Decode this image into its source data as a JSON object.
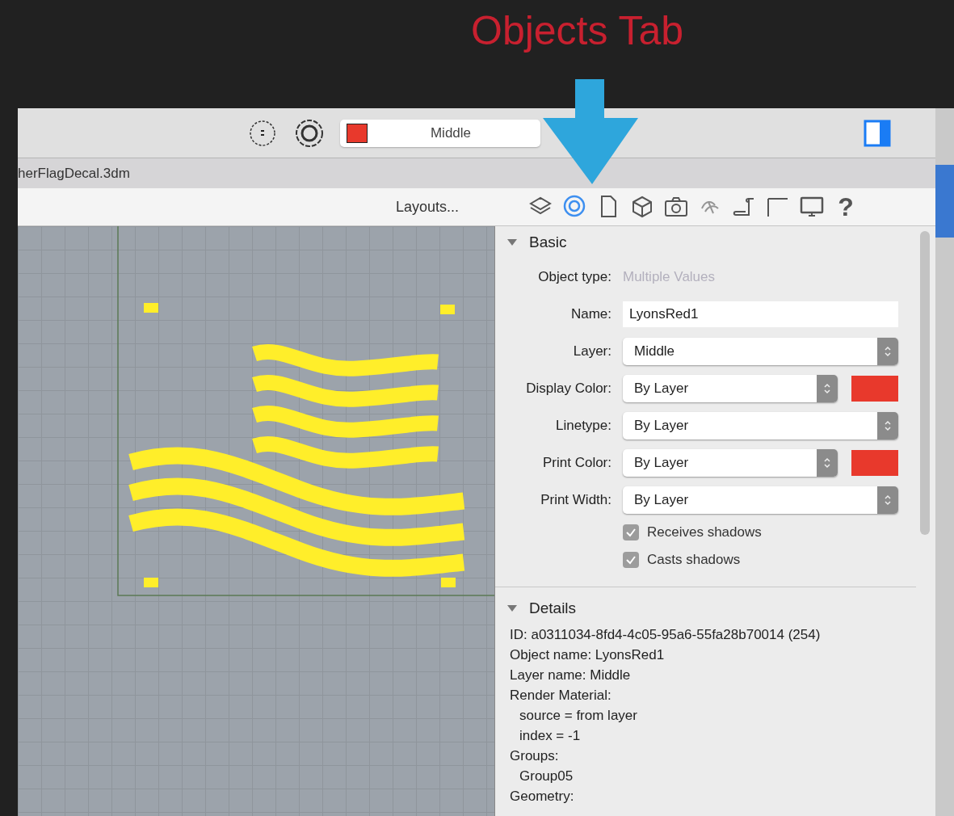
{
  "annotation": {
    "title": "Objects Tab"
  },
  "toolbar": {
    "layer": {
      "name": "Middle",
      "color": "#e8392c"
    }
  },
  "document_tab": {
    "title": "herFlagDecal.3dm"
  },
  "layouts_button": {
    "label": "Layouts..."
  },
  "panel_tabs": [
    {
      "kind": "layers",
      "selected": false
    },
    {
      "kind": "objects",
      "selected": true
    },
    {
      "kind": "document",
      "selected": false
    },
    {
      "kind": "box",
      "selected": false
    },
    {
      "kind": "camera",
      "selected": false
    },
    {
      "kind": "lights",
      "selected": false
    },
    {
      "kind": "scroll",
      "selected": false
    },
    {
      "kind": "line",
      "selected": false
    },
    {
      "kind": "display",
      "selected": false
    },
    {
      "kind": "help",
      "selected": false,
      "label": "?"
    }
  ],
  "basic": {
    "title": "Basic",
    "expanded": true,
    "rows": [
      {
        "kind": "readonly",
        "label": "Object type:",
        "value": "Multiple Values"
      },
      {
        "kind": "text",
        "label": "Name:",
        "value": "LyonsRed1"
      },
      {
        "kind": "select",
        "label": "Layer:",
        "value": "Middle"
      },
      {
        "kind": "color",
        "label": "Display Color:",
        "value": "By Layer",
        "color": "#e8392c"
      },
      {
        "kind": "select",
        "label": "Linetype:",
        "value": "By Layer"
      },
      {
        "kind": "color",
        "label": "Print Color:",
        "value": "By Layer",
        "color": "#e8392c"
      },
      {
        "kind": "select",
        "label": "Print Width:",
        "value": "By Layer"
      }
    ],
    "checkboxes": [
      {
        "label": "Receives shadows",
        "checked": true
      },
      {
        "label": "Casts shadows",
        "checked": true
      }
    ]
  },
  "details": {
    "title": "Details",
    "expanded": true,
    "lines": [
      {
        "text": "ID: a0311034-8fd4-4c05-95a6-55fa28b70014 (254)"
      },
      {
        "text": "Object name: LyonsRed1"
      },
      {
        "text": "Layer name: Middle"
      },
      {
        "text": "Render Material:",
        "children": [
          {
            "text": "source = from layer"
          },
          {
            "text": "index = -1"
          }
        ]
      },
      {
        "text": "Groups:",
        "children": [
          {
            "text": "Group05"
          }
        ]
      },
      {
        "text": "Geometry:"
      }
    ]
  }
}
